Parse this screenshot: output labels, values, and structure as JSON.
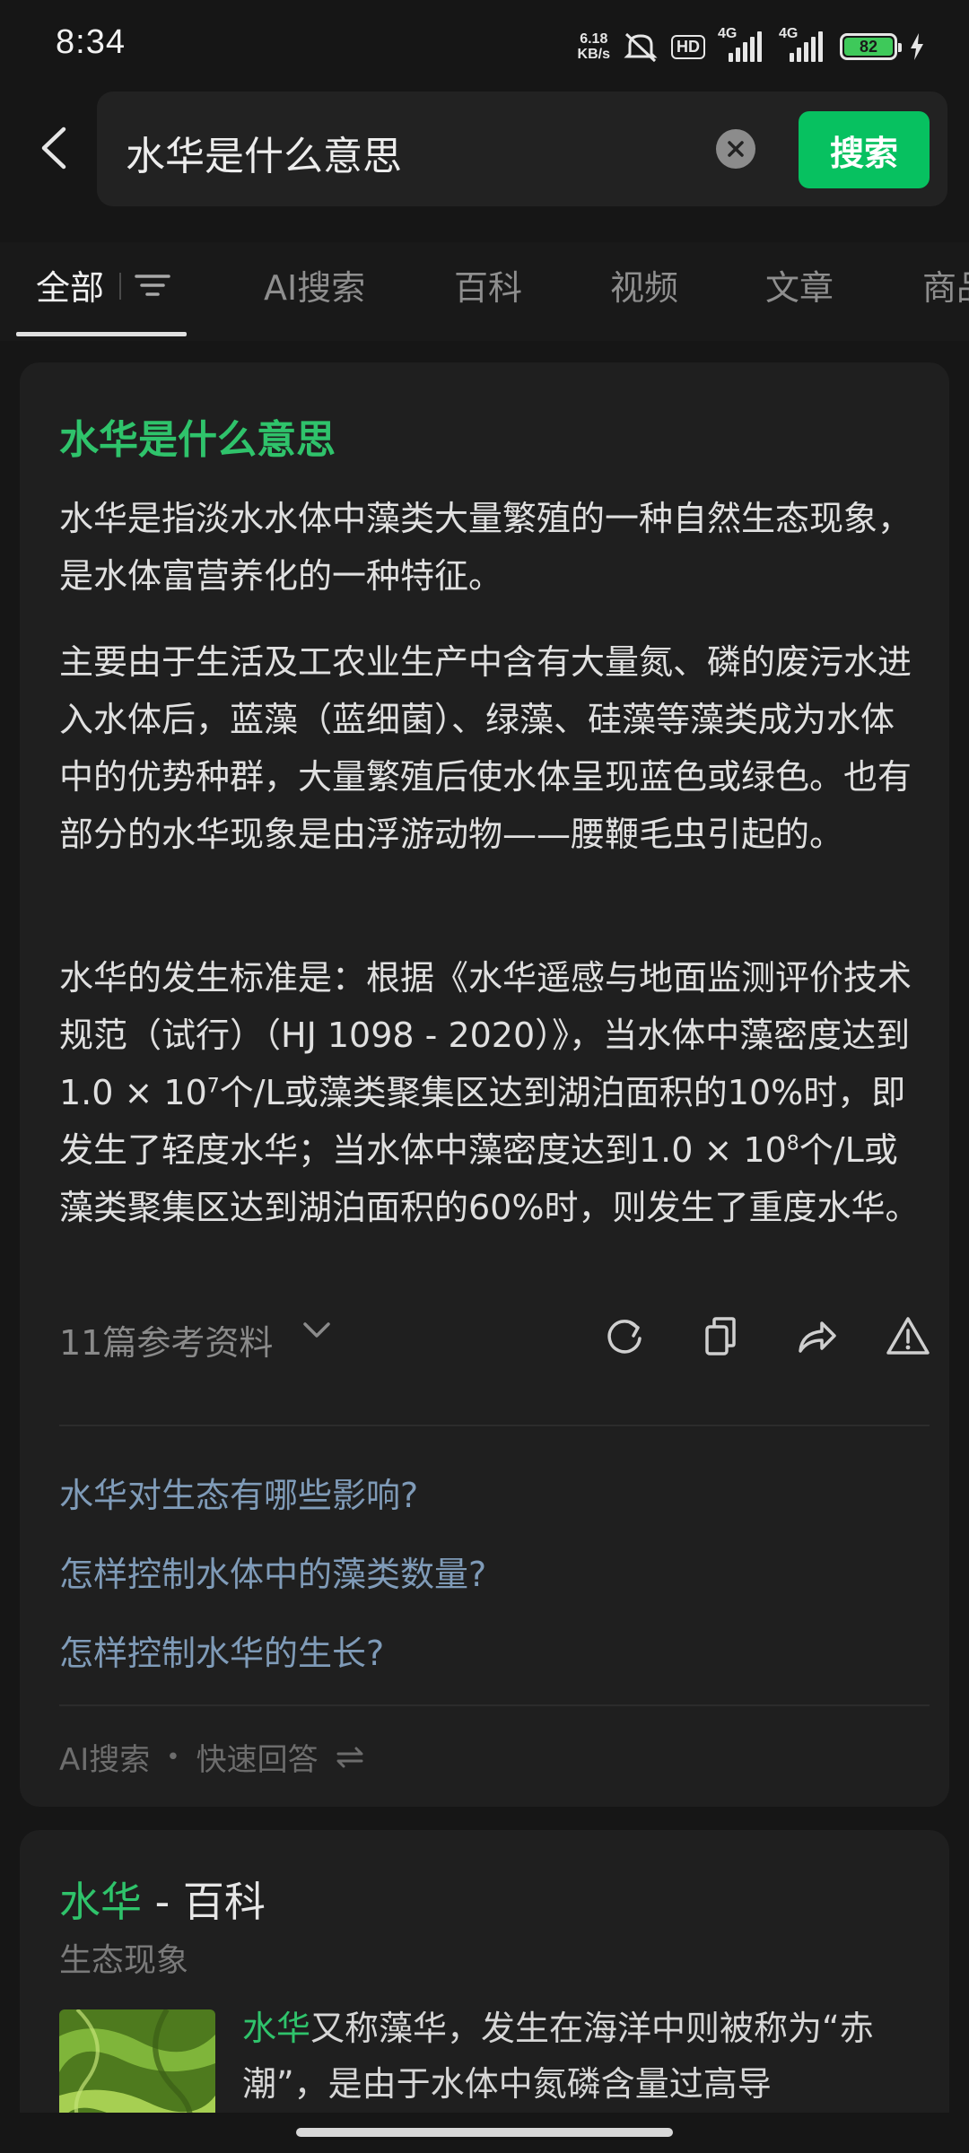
{
  "status_bar": {
    "time": "8:34",
    "net_speed_value": "6.18",
    "net_speed_unit": "KB/s",
    "hd_label": "HD",
    "signal1_label": "4G",
    "signal2_label": "4G",
    "battery_level": "82"
  },
  "search": {
    "query": "水华是什么意思",
    "button_label": "搜索"
  },
  "tabs": [
    {
      "label": "全部"
    },
    {
      "label": "AI搜索"
    },
    {
      "label": "百科"
    },
    {
      "label": "视频"
    },
    {
      "label": "文章"
    },
    {
      "label": "商品"
    }
  ],
  "ai_answer": {
    "title": "水华是什么意思",
    "para1": "水华是指淡水水体中藻类大量繁殖的一种自然生态现象，是水体富营养化的一种特征。",
    "para2": "主要由于生活及工农业生产中含有大量氮、磷的废污水进入水体后，蓝藻（蓝细菌）、绿藻、硅藻等藻类成为水体中的优势种群，大量繁殖后使水体呈现蓝色或绿色。也有部分的水华现象是由浮游动物——腰鞭毛虫引起的。",
    "para3_a": "水华的发生标准是：根据《水华遥感与地面监测评价技术规范（试行）（HJ 1098 - 2020）》，当水体中藻密度达到1.0 × 10",
    "para3_exp1": "7",
    "para3_b": "个/L或藻类聚集区达到湖泊面积的10%时，即发生了轻度水华；当水体中藻密度达到1.0 × 10",
    "para3_exp2": "8",
    "para3_c": "个/L或藻类聚集区达到湖泊面积的60%时，则发生了重度水华。",
    "references_label": "11篇参考资料",
    "suggestions": [
      "水华对生态有哪些影响?",
      "怎样控制水体中的藻类数量?",
      "怎样控制水华的生长?"
    ],
    "footer_source": "AI搜索",
    "footer_dot": "•",
    "footer_mode": "快速回答"
  },
  "wiki": {
    "title_highlight": "水华",
    "title_suffix": " - 百科",
    "subtitle": "生态现象",
    "text_highlight": "水华",
    "text_rest": "又称藻华，发生在海洋中则被称为“赤潮”，是由于水体中氮磷含量过高导"
  }
}
